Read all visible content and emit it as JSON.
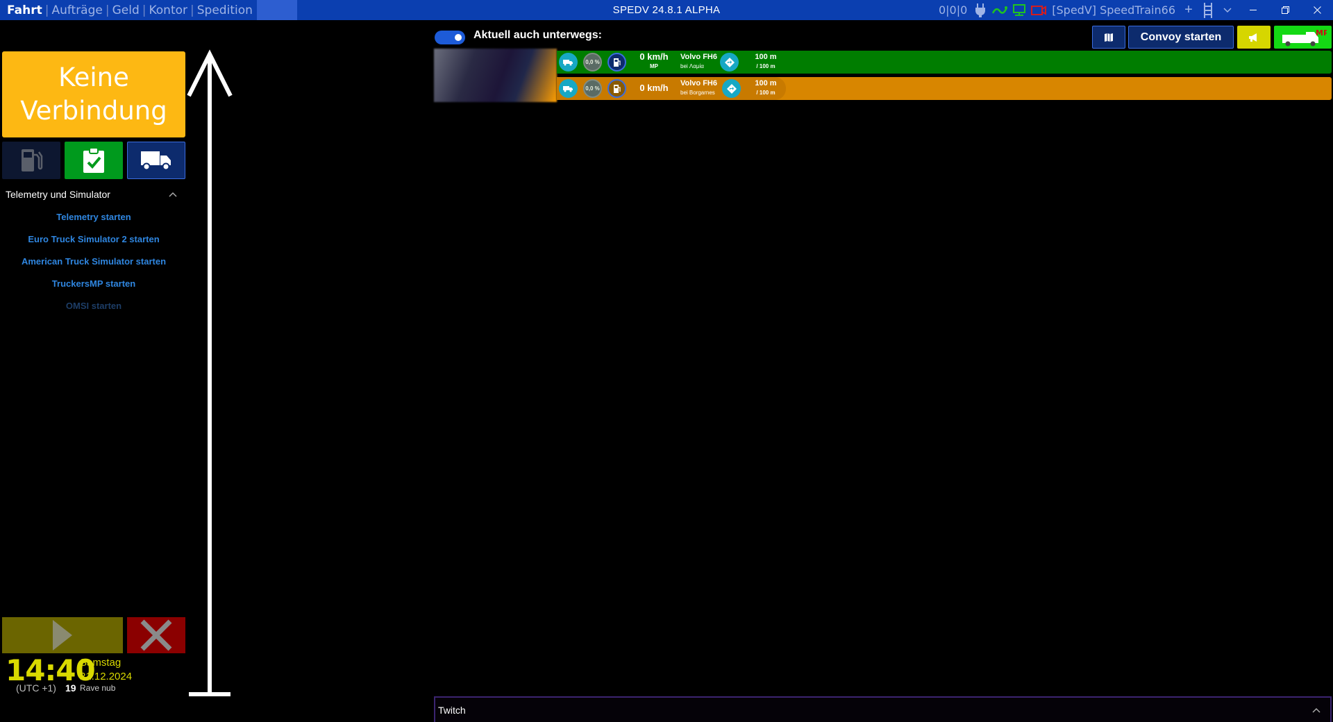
{
  "titlebar": {
    "nav": [
      "Fahrt",
      "Aufträge",
      "Geld",
      "Kontor",
      "Spedition"
    ],
    "active_nav": "Fahrt",
    "app_title": "SPEDV 24.8.1 ALPHA",
    "counter": "0|0|0",
    "user": "[SpedV] SpeedTrain66"
  },
  "sidebar": {
    "status": "Keine Verbindung",
    "section_title": "Telemetry und Simulator",
    "launchers": [
      {
        "label": "Telemetry starten",
        "enabled": true
      },
      {
        "label": "Euro Truck Simulator 2 starten",
        "enabled": true
      },
      {
        "label": "American Truck Simulator starten",
        "enabled": true
      },
      {
        "label": "TruckersMP starten",
        "enabled": true
      },
      {
        "label": "OMSI starten",
        "enabled": false
      }
    ],
    "clock": {
      "time": "14:40",
      "weekday": "Samstag",
      "date": "21.12.2024",
      "timezone": "(UTC +1)",
      "count": "19",
      "nick": "Rave nub"
    }
  },
  "main": {
    "toggle_label": "Aktuell auch unterwegs:",
    "convoy_label": "Convoy starten",
    "drivers": [
      {
        "pct": "0,0 %",
        "speed": "0 km/h",
        "speed_sub": "MP",
        "truck": "Volvo FH6",
        "location": "bei Λαμία",
        "dist": "100 m",
        "dist_sub": "/ 100 m"
      },
      {
        "pct": "0,0 %",
        "speed": "0 km/h",
        "speed_sub": "",
        "truck": "Volvo FH6",
        "location": "bei Borgarnes",
        "dist": "100 m",
        "dist_sub": "/ 100 m"
      }
    ],
    "twitch_label": "Twitch"
  },
  "colors": {
    "titlebar": "#0b3fb0",
    "status_box": "#fdb813",
    "row_green": "#007d00",
    "row_orange": "#d88600",
    "clock": "#d9d900"
  }
}
